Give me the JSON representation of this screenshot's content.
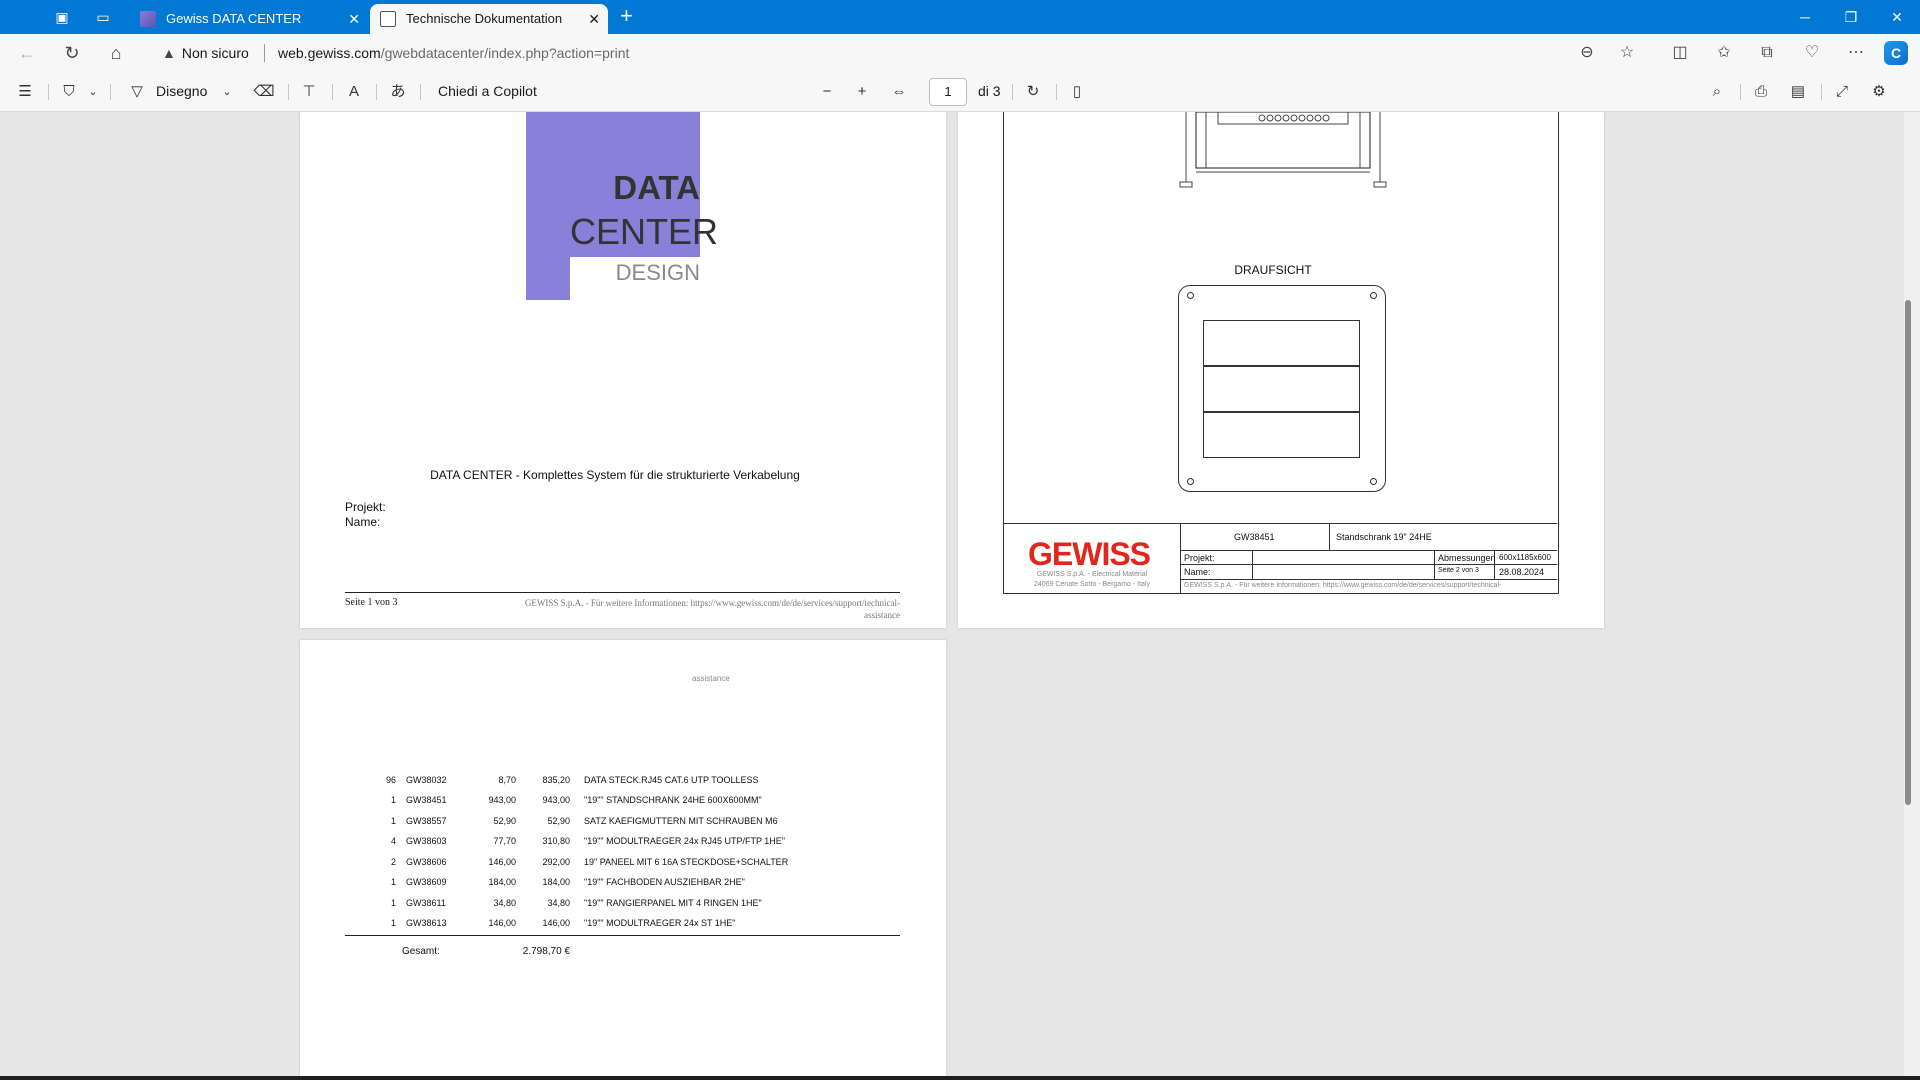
{
  "browser": {
    "tabs": [
      {
        "title": "Gewiss DATA CENTER",
        "active": false
      },
      {
        "title": "Technische Dokumentation",
        "active": true
      }
    ],
    "security_label": "Non sicuro",
    "url_host": "web.gewiss.com",
    "url_path": "/gwebdatacenter/index.php?action=print"
  },
  "pdf_toolbar": {
    "draw_label": "Disegno",
    "copilot_label": "Chiedi a Copilot",
    "page_current": "1",
    "page_total": "di 3"
  },
  "page1": {
    "logo": {
      "line1": "DATA",
      "line2": "CENTER",
      "line3": "DESIGN"
    },
    "title": "DATA CENTER - Komplettes System für die strukturierte Verkabelung",
    "projekt_label": "Projekt:",
    "name_label": "Name:",
    "footer_page": "Seite 1 von 3",
    "footer_info_line1": "GEWISS S.p.A. - Für weitere Informationen: https://www.gewiss.com/de/de/services/support/technical-",
    "footer_info_line2": "assistance"
  },
  "page2": {
    "view_label": "DRAUFSICHT",
    "brand": "GEWISS",
    "brand_address_line1": "GEWISS S.p.A. - Electrical Material",
    "brand_address_line2": "24069 Cenate Sotto - Bergamo - Italy",
    "code": "GW38451",
    "description": "Standschrank 19\" 24HE",
    "projekt_label": "Projekt:",
    "name_label": "Name:",
    "abmessungen_label": "Abmessungen",
    "abmessungen_value": "600x1185x600",
    "seite": "Seite 2 von 3",
    "date": "28.08.2024",
    "footer_info": "GEWISS S.p.A. - Für weitere Informationen: https://www.gewiss.com/de/de/services/support/technical-"
  },
  "page3": {
    "assistance": "assistance",
    "items": [
      {
        "qty": "96",
        "code": "GW38032",
        "unit": "8,70",
        "total": "835,20",
        "desc": "DATA STECK.RJ45 CAT.6 UTP TOOLLESS"
      },
      {
        "qty": "1",
        "code": "GW38451",
        "unit": "943,00",
        "total": "943,00",
        "desc": "\"19\"\" STANDSCHRANK 24HE 600X600MM\""
      },
      {
        "qty": "1",
        "code": "GW38557",
        "unit": "52,90",
        "total": "52,90",
        "desc": "SATZ KAEFIGMUTTERN MIT SCHRAUBEN M6"
      },
      {
        "qty": "4",
        "code": "GW38603",
        "unit": "77,70",
        "total": "310,80",
        "desc": "\"19\"\" MODULTRAEGER 24x RJ45 UTP/FTP 1HE\""
      },
      {
        "qty": "2",
        "code": "GW38606",
        "unit": "146,00",
        "total": "292,00",
        "desc": "19\" PANEEL MIT 6 16A STECKDOSE+SCHALTER"
      },
      {
        "qty": "1",
        "code": "GW38609",
        "unit": "184,00",
        "total": "184,00",
        "desc": "\"19\"\" FACHBODEN AUSZIEHBAR 2HE\""
      },
      {
        "qty": "1",
        "code": "GW38611",
        "unit": "34,80",
        "total": "34,80",
        "desc": "\"19\"\" RANGIERPANEL MIT 4 RINGEN 1HE\""
      },
      {
        "qty": "1",
        "code": "GW38613",
        "unit": "146,00",
        "total": "146,00",
        "desc": "\"19\"\" MODULTRAEGER 24x ST 1HE\""
      }
    ],
    "total_label": "Gesamt:",
    "total_value": "2.798,70 €"
  },
  "colors": {
    "titlebar": "#0078d4",
    "logo_purple": "#8880d9",
    "gewiss_red": "#e2261b"
  }
}
